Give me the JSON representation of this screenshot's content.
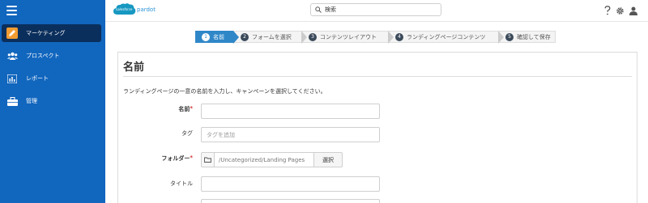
{
  "sidebar": {
    "items": [
      {
        "label": "マーケティング",
        "icon": "pencil-icon",
        "active": true
      },
      {
        "label": "プロスペクト",
        "icon": "people-icon",
        "active": false
      },
      {
        "label": "レポート",
        "icon": "chart-icon",
        "active": false
      },
      {
        "label": "管理",
        "icon": "briefcase-icon",
        "active": false
      }
    ]
  },
  "topbar": {
    "logo_cloud": "salesforce",
    "logo_text": "pardot",
    "search_placeholder": "検索",
    "icons": [
      "help-icon",
      "gear-icon",
      "user-icon"
    ]
  },
  "steps": [
    {
      "num": "1",
      "label": "名前",
      "active": true
    },
    {
      "num": "2",
      "label": "フォームを選択",
      "active": false
    },
    {
      "num": "3",
      "label": "コンテンツレイアウト",
      "active": false
    },
    {
      "num": "4",
      "label": "ランディングページコンテンツ",
      "active": false
    },
    {
      "num": "5",
      "label": "確認して保存",
      "active": false
    }
  ],
  "panel": {
    "title": "名前",
    "description": "ランディングページの一意の名前を入力し、キャンペーンを選択してください。",
    "fields": {
      "name_label": "名前",
      "name_required": "*",
      "name_value": "",
      "tag_label": "タグ",
      "tag_placeholder": "タグを追加",
      "folder_label": "フォルダー",
      "folder_required": "*",
      "folder_path": "/Uncategorized/Landing Pages",
      "folder_button": "選択",
      "title_label": "タイトル",
      "title_value": ""
    }
  },
  "colors": {
    "sidebar_bg": "#1166be",
    "sidebar_active": "#0b2f5c",
    "step_active": "#2f87c8",
    "required": "#d9302f"
  }
}
